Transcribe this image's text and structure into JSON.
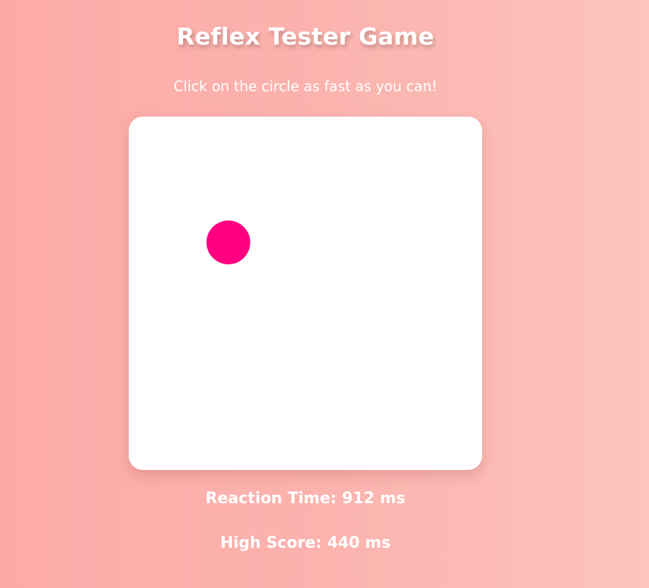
{
  "page": {
    "title": "Reflex Tester Game",
    "instructions": "Click on the circle as fast as you can!"
  },
  "game": {
    "target_color": "#ff0080",
    "board_color": "#ffffff"
  },
  "stats": {
    "reaction_time_label": "Reaction Time: 912 ms",
    "high_score_label": "High Score: 440 ms"
  }
}
